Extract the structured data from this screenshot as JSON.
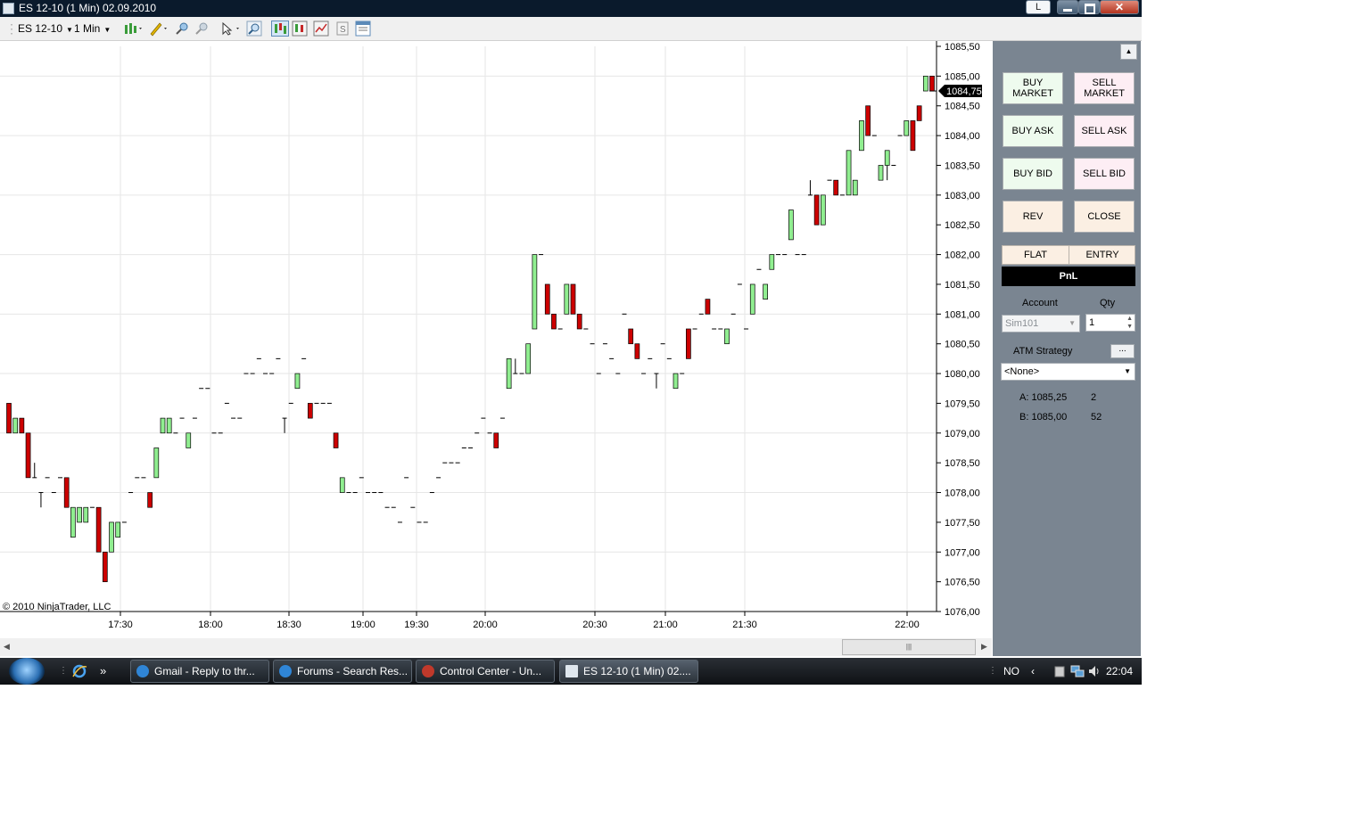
{
  "window": {
    "title": "ES 12-10 (1 Min)  02.09.2010",
    "lang_button": "L",
    "close_glyph": "✕"
  },
  "toolbar": {
    "instrument": "ES 12-10",
    "period": "1 Min",
    "icons": [
      "bars-icon",
      "pencil-icon",
      "zoom-in-icon",
      "zoom-out-icon",
      "pointer-icon",
      "search-icon",
      "chart-trader-icon",
      "data-box-icon",
      "indicators-icon",
      "strategies-icon",
      "properties-icon"
    ]
  },
  "chart": {
    "copyright": "© 2010 NinjaTrader, LLC",
    "current_price": "1084,75",
    "colors": {
      "up": "#90ee90",
      "down": "#cc0000",
      "grid": "#e6e6e6"
    }
  },
  "chart_data": {
    "type": "bar",
    "subtype": "candlestick",
    "ylim": [
      1076.0,
      1085.5
    ],
    "y_ticks": [
      "1085,50",
      "1085,00",
      "1084,50",
      "1084,00",
      "1083,50",
      "1083,00",
      "1082,50",
      "1082,00",
      "1081,50",
      "1081,00",
      "1080,50",
      "1080,00",
      "1079,50",
      "1079,00",
      "1078,50",
      "1078,00",
      "1077,50",
      "1077,00",
      "1076,50",
      "1076,00"
    ],
    "x_ticks": [
      "17:30",
      "18:00",
      "18:30",
      "19:00",
      "19:30",
      "20:00",
      "20:30",
      "21:00",
      "21:30",
      "22:00"
    ],
    "candles": [
      [
        1079.5,
        1079.5,
        1079.0,
        1079.0
      ],
      [
        1079.0,
        1079.25,
        1079.0,
        1079.25
      ],
      [
        1079.25,
        1079.25,
        1079.0,
        1079.0
      ],
      [
        1079.0,
        1079.0,
        1078.25,
        1078.25
      ],
      [
        1078.25,
        1078.5,
        1078.25,
        1078.25
      ],
      [
        1078.0,
        1078.0,
        1077.75,
        1078.0
      ],
      [
        1078.25,
        1078.25,
        1078.25,
        1078.25
      ],
      [
        1078.0,
        1078.0,
        1078.0,
        1078.0
      ],
      [
        1078.25,
        1078.25,
        1078.25,
        1078.25
      ],
      [
        1078.25,
        1078.25,
        1077.75,
        1077.75
      ],
      [
        1077.25,
        1077.75,
        1077.25,
        1077.75
      ],
      [
        1077.5,
        1077.75,
        1077.5,
        1077.75
      ],
      [
        1077.5,
        1077.75,
        1077.5,
        1077.75
      ],
      [
        1077.75,
        1077.75,
        1077.75,
        1077.75
      ],
      [
        1077.75,
        1077.75,
        1077.0,
        1077.0
      ],
      [
        1077.0,
        1077.0,
        1076.5,
        1076.5
      ],
      [
        1077.0,
        1077.5,
        1077.0,
        1077.5
      ],
      [
        1077.25,
        1077.5,
        1077.25,
        1077.5
      ],
      [
        1077.5,
        1077.5,
        1077.5,
        1077.5
      ],
      [
        1078.0,
        1078.0,
        1078.0,
        1078.0
      ],
      [
        1078.25,
        1078.25,
        1078.25,
        1078.25
      ],
      [
        1078.25,
        1078.25,
        1078.25,
        1078.25
      ],
      [
        1078.0,
        1078.0,
        1077.75,
        1077.75
      ],
      [
        1078.25,
        1078.75,
        1078.25,
        1078.75
      ],
      [
        1079.0,
        1079.25,
        1079.0,
        1079.25
      ],
      [
        1079.0,
        1079.25,
        1079.0,
        1079.25
      ],
      [
        1079.0,
        1079.0,
        1079.0,
        1079.0
      ],
      [
        1079.25,
        1079.25,
        1079.25,
        1079.25
      ],
      [
        1078.75,
        1079.0,
        1078.75,
        1079.0
      ],
      [
        1079.25,
        1079.25,
        1079.25,
        1079.25
      ],
      [
        1079.75,
        1079.75,
        1079.75,
        1079.75
      ],
      [
        1079.75,
        1079.75,
        1079.75,
        1079.75
      ],
      [
        1079.0,
        1079.0,
        1079.0,
        1079.0
      ],
      [
        1079.0,
        1079.0,
        1079.0,
        1079.0
      ],
      [
        1079.5,
        1079.5,
        1079.5,
        1079.5
      ],
      [
        1079.25,
        1079.25,
        1079.25,
        1079.25
      ],
      [
        1079.25,
        1079.25,
        1079.25,
        1079.25
      ],
      [
        1080.0,
        1080.0,
        1080.0,
        1080.0
      ],
      [
        1080.0,
        1080.0,
        1080.0,
        1080.0
      ],
      [
        1080.25,
        1080.25,
        1080.25,
        1080.25
      ],
      [
        1080.0,
        1080.0,
        1080.0,
        1080.0
      ],
      [
        1080.0,
        1080.0,
        1080.0,
        1080.0
      ],
      [
        1080.25,
        1080.25,
        1080.25,
        1080.25
      ],
      [
        1079.25,
        1079.25,
        1079.0,
        1079.25
      ],
      [
        1079.5,
        1079.5,
        1079.5,
        1079.5
      ],
      [
        1079.75,
        1080.0,
        1079.75,
        1080.0
      ],
      [
        1080.25,
        1080.25,
        1080.25,
        1080.25
      ],
      [
        1079.5,
        1079.5,
        1079.25,
        1079.25
      ],
      [
        1079.5,
        1079.5,
        1079.5,
        1079.5
      ],
      [
        1079.5,
        1079.5,
        1079.5,
        1079.5
      ],
      [
        1079.5,
        1079.5,
        1079.5,
        1079.5
      ],
      [
        1079.0,
        1079.0,
        1078.75,
        1078.75
      ],
      [
        1078.0,
        1078.25,
        1078.0,
        1078.25
      ],
      [
        1078.0,
        1078.0,
        1078.0,
        1078.0
      ],
      [
        1078.0,
        1078.0,
        1078.0,
        1078.0
      ],
      [
        1078.25,
        1078.25,
        1078.25,
        1078.25
      ],
      [
        1078.0,
        1078.0,
        1078.0,
        1078.0
      ],
      [
        1078.0,
        1078.0,
        1078.0,
        1078.0
      ],
      [
        1078.0,
        1078.0,
        1078.0,
        1078.0
      ],
      [
        1077.75,
        1077.75,
        1077.75,
        1077.75
      ],
      [
        1077.75,
        1077.75,
        1077.75,
        1077.75
      ],
      [
        1077.5,
        1077.5,
        1077.5,
        1077.5
      ],
      [
        1078.25,
        1078.25,
        1078.25,
        1078.25
      ],
      [
        1077.75,
        1077.75,
        1077.75,
        1077.75
      ],
      [
        1077.5,
        1077.5,
        1077.5,
        1077.5
      ],
      [
        1077.5,
        1077.5,
        1077.5,
        1077.5
      ],
      [
        1078.0,
        1078.0,
        1078.0,
        1078.0
      ],
      [
        1078.25,
        1078.25,
        1078.25,
        1078.25
      ],
      [
        1078.5,
        1078.5,
        1078.5,
        1078.5
      ],
      [
        1078.5,
        1078.5,
        1078.5,
        1078.5
      ],
      [
        1078.5,
        1078.5,
        1078.5,
        1078.5
      ],
      [
        1078.75,
        1078.75,
        1078.75,
        1078.75
      ],
      [
        1078.75,
        1078.75,
        1078.75,
        1078.75
      ],
      [
        1079.0,
        1079.0,
        1079.0,
        1079.0
      ],
      [
        1079.25,
        1079.25,
        1079.25,
        1079.25
      ],
      [
        1079.0,
        1079.0,
        1079.0,
        1079.0
      ],
      [
        1079.0,
        1079.0,
        1078.75,
        1078.75
      ],
      [
        1079.25,
        1079.25,
        1079.25,
        1079.25
      ],
      [
        1079.75,
        1080.25,
        1079.75,
        1080.25
      ],
      [
        1080.0,
        1080.25,
        1080.0,
        1080.0
      ],
      [
        1080.0,
        1080.0,
        1080.0,
        1080.0
      ],
      [
        1080.0,
        1080.5,
        1080.0,
        1080.5
      ],
      [
        1080.75,
        1082.0,
        1080.75,
        1082.0
      ],
      [
        1082.0,
        1082.0,
        1082.0,
        1082.0
      ],
      [
        1081.5,
        1081.5,
        1081.0,
        1081.0
      ],
      [
        1081.0,
        1081.0,
        1080.75,
        1080.75
      ],
      [
        1080.75,
        1080.75,
        1080.75,
        1080.75
      ],
      [
        1081.0,
        1081.5,
        1081.0,
        1081.5
      ],
      [
        1081.5,
        1081.5,
        1081.0,
        1081.0
      ],
      [
        1081.0,
        1081.0,
        1080.75,
        1080.75
      ],
      [
        1080.75,
        1080.75,
        1080.75,
        1080.75
      ],
      [
        1080.5,
        1080.5,
        1080.5,
        1080.5
      ],
      [
        1080.0,
        1080.0,
        1080.0,
        1080.0
      ],
      [
        1080.5,
        1080.5,
        1080.5,
        1080.5
      ],
      [
        1080.25,
        1080.25,
        1080.25,
        1080.25
      ],
      [
        1080.0,
        1080.0,
        1080.0,
        1080.0
      ],
      [
        1081.0,
        1081.0,
        1081.0,
        1081.0
      ],
      [
        1080.75,
        1080.75,
        1080.5,
        1080.5
      ],
      [
        1080.5,
        1080.5,
        1080.25,
        1080.25
      ],
      [
        1080.0,
        1080.0,
        1080.0,
        1080.0
      ],
      [
        1080.25,
        1080.25,
        1080.25,
        1080.25
      ],
      [
        1080.0,
        1080.0,
        1079.75,
        1080.0
      ],
      [
        1080.5,
        1080.5,
        1080.5,
        1080.5
      ],
      [
        1080.25,
        1080.25,
        1080.25,
        1080.25
      ],
      [
        1079.75,
        1080.0,
        1079.75,
        1080.0
      ],
      [
        1080.0,
        1080.0,
        1080.0,
        1080.0
      ],
      [
        1080.75,
        1080.75,
        1080.25,
        1080.25
      ],
      [
        1080.75,
        1080.75,
        1080.75,
        1080.75
      ],
      [
        1081.0,
        1081.0,
        1081.0,
        1081.0
      ],
      [
        1081.25,
        1081.25,
        1081.0,
        1081.0
      ],
      [
        1080.75,
        1080.75,
        1080.75,
        1080.75
      ],
      [
        1080.75,
        1080.75,
        1080.75,
        1080.75
      ],
      [
        1080.5,
        1080.75,
        1080.5,
        1080.75
      ],
      [
        1081.0,
        1081.0,
        1081.0,
        1081.0
      ],
      [
        1081.5,
        1081.5,
        1081.5,
        1081.5
      ],
      [
        1080.75,
        1080.75,
        1080.75,
        1080.75
      ],
      [
        1081.0,
        1081.5,
        1081.0,
        1081.5
      ],
      [
        1081.75,
        1081.75,
        1081.75,
        1081.75
      ],
      [
        1081.25,
        1081.5,
        1081.25,
        1081.5
      ],
      [
        1081.75,
        1082.0,
        1081.75,
        1082.0
      ],
      [
        1082.0,
        1082.0,
        1082.0,
        1082.0
      ],
      [
        1082.0,
        1082.0,
        1082.0,
        1082.0
      ],
      [
        1082.25,
        1082.75,
        1082.25,
        1082.75
      ],
      [
        1082.0,
        1082.0,
        1082.0,
        1082.0
      ],
      [
        1082.0,
        1082.0,
        1082.0,
        1082.0
      ],
      [
        1083.0,
        1083.25,
        1083.0,
        1083.0
      ],
      [
        1083.0,
        1083.0,
        1082.5,
        1082.5
      ],
      [
        1082.5,
        1083.0,
        1082.5,
        1083.0
      ],
      [
        1083.25,
        1083.25,
        1083.25,
        1083.25
      ],
      [
        1083.25,
        1083.25,
        1083.0,
        1083.0
      ],
      [
        1083.0,
        1083.0,
        1083.0,
        1083.0
      ],
      [
        1083.0,
        1083.75,
        1083.0,
        1083.75
      ],
      [
        1083.0,
        1083.25,
        1083.0,
        1083.25
      ],
      [
        1083.75,
        1084.25,
        1083.75,
        1084.25
      ],
      [
        1084.5,
        1084.5,
        1084.0,
        1084.0
      ],
      [
        1084.0,
        1084.0,
        1084.0,
        1084.0
      ],
      [
        1083.25,
        1083.5,
        1083.25,
        1083.5
      ],
      [
        1083.5,
        1083.75,
        1083.25,
        1083.75
      ],
      [
        1083.5,
        1083.5,
        1083.5,
        1083.5
      ],
      [
        1084.0,
        1084.0,
        1084.0,
        1084.0
      ],
      [
        1084.0,
        1084.25,
        1084.0,
        1084.25
      ],
      [
        1084.25,
        1084.25,
        1083.75,
        1083.75
      ],
      [
        1084.5,
        1084.5,
        1084.25,
        1084.25
      ],
      [
        1084.75,
        1085.0,
        1084.75,
        1085.0
      ],
      [
        1085.0,
        1085.0,
        1084.75,
        1084.75
      ]
    ]
  },
  "panel": {
    "buttons": {
      "buy_market": "BUY\nMARKET",
      "sell_market": "SELL\nMARKET",
      "buy_ask": "BUY ASK",
      "sell_ask": "SELL ASK",
      "buy_bid": "BUY BID",
      "sell_bid": "SELL BID",
      "rev": "REV",
      "close": "CLOSE"
    },
    "position": "FLAT",
    "entry": "ENTRY",
    "pnl": "PnL",
    "account_label": "Account",
    "qty_label": "Qty",
    "account": "Sim101",
    "qty": "1",
    "atm_label": "ATM Strategy",
    "atm_button": "...",
    "atm_value": "<None>",
    "ask_label": "A: 1085,25",
    "ask_size": "2",
    "bid_label": "B: 1085,00",
    "bid_size": "52"
  },
  "taskbar": {
    "tasks": [
      "Gmail - Reply to thr...",
      "Forums - Search Res...",
      "Control Center - Un...",
      "ES 12-10 (1 Min)  02...."
    ],
    "lang": "NO",
    "clock": "22:04",
    "more": "»"
  }
}
